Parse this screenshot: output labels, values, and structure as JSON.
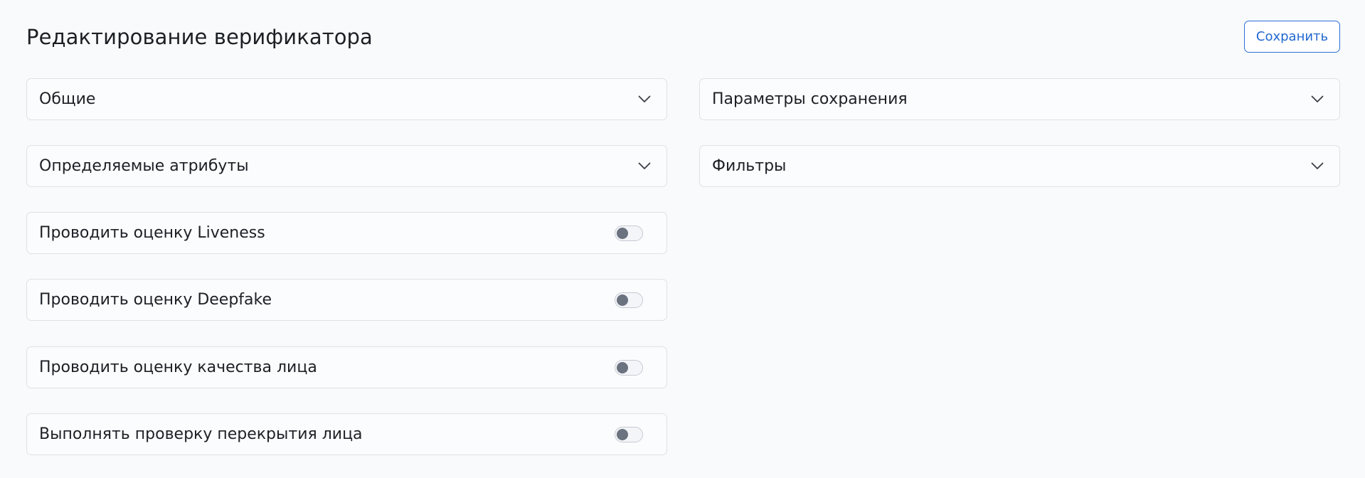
{
  "header": {
    "title": "Редактирование верификатора",
    "save_label": "Сохранить"
  },
  "left_column": {
    "accordions": [
      {
        "label": "Общие",
        "icon": "chevron-down-icon"
      },
      {
        "label": "Определяемые атрибуты",
        "icon": "chevron-down-icon"
      }
    ],
    "toggles": [
      {
        "label": "Проводить оценку Liveness",
        "enabled": false
      },
      {
        "label": "Проводить оценку Deepfake",
        "enabled": false
      },
      {
        "label": "Проводить оценку качества лица",
        "enabled": false
      },
      {
        "label": "Выполнять проверку перекрытия лица",
        "enabled": false
      }
    ]
  },
  "right_column": {
    "accordions": [
      {
        "label": "Параметры сохранения",
        "icon": "chevron-down-icon"
      },
      {
        "label": "Фильтры",
        "icon": "chevron-down-icon"
      }
    ]
  },
  "colors": {
    "accent": "#2068d0",
    "toggle_knob_off": "#6b7280",
    "card_border": "#dde1e6",
    "background": "#f9fafc"
  }
}
